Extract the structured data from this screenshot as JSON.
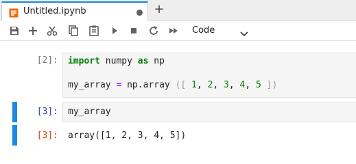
{
  "tab": {
    "title": "Untitled.ipynb",
    "icon": "notebook-icon",
    "dirty": true
  },
  "new_tab_symbol": "+",
  "toolbar": {
    "buttons": [
      "save-icon",
      "add-icon",
      "cut-icon",
      "copy-icon",
      "paste-icon",
      "run-icon",
      "stop-icon",
      "restart-icon",
      "fast-forward-icon"
    ],
    "cell_type": "Code"
  },
  "cells": [
    {
      "prompt": "[2]:",
      "line1": {
        "kw1": "import",
        "t1": " numpy ",
        "kw2": "as",
        "t2": " np"
      },
      "line2": {
        "t1": "my_array ",
        "op": "=",
        "t2": " np.array ",
        "b1": "([ ",
        "n1": "1",
        "c1": ", ",
        "n2": "2",
        "c2": ", ",
        "n3": "3",
        "c3": ", ",
        "n4": "4",
        "c4": ", ",
        "n5": "5",
        "b2": " ])"
      }
    },
    {
      "prompt": "[3]:",
      "code": "my_array",
      "out_prompt": "[3]:",
      "output": "array([1, 2, 3, 4, 5])"
    }
  ],
  "colors": {
    "accent": "#1e88e5",
    "out_prompt": "#d84315",
    "keyword": "#008000"
  }
}
